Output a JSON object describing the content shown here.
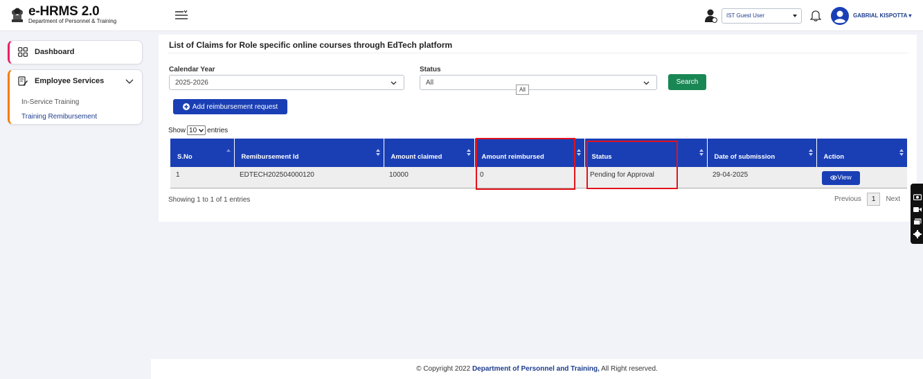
{
  "header": {
    "app_title": "e-HRMS 2.0",
    "app_subtitle": "Department of Personnel & Training",
    "role_selected": "IST Guest User",
    "user_name": "GABRIAL KISPOTTA",
    "user_caret": "▾"
  },
  "sidebar": {
    "items": [
      {
        "label": "Dashboard",
        "icon": "grid-icon",
        "accent": "#e91e63"
      },
      {
        "label": "Employee Services",
        "icon": "edit-document-icon",
        "accent": "#f57c00",
        "children": [
          {
            "label": "In-Service Training"
          },
          {
            "label": "Training Remibursement",
            "active": true
          }
        ]
      }
    ]
  },
  "main": {
    "title": "List of Claims for Role specific online courses through EdTech platform",
    "filters": {
      "year_label": "Calendar Year",
      "year_value": "2025-2026",
      "status_label": "Status",
      "status_value": "All",
      "status_tooltip": "All",
      "search_label": "Search"
    },
    "add_button_label": "Add reimbursement request",
    "length": {
      "prefix": "Show",
      "value": "10",
      "suffix": "entries"
    },
    "table": {
      "columns": [
        "S.No",
        "Remibursement Id",
        "Amount claimed",
        "Amount reimbursed",
        "Status",
        "Date of submission",
        "Action"
      ],
      "rows": [
        {
          "sno": "1",
          "id": "EDTECH202504000120",
          "claimed": "10000",
          "reimbursed": "0",
          "status": "Pending for Approval",
          "date": "29-04-2025",
          "action": "View"
        }
      ]
    },
    "info": "Showing 1 to 1 of 1 entries",
    "pager": {
      "prev": "Previous",
      "current": "1",
      "next": "Next"
    }
  },
  "footer": {
    "prefix": "© Copyright 2022",
    "org": "Department of Personnel and Training,",
    "suffix": "All Right reserved."
  },
  "colors": {
    "primary": "#1a3fb5",
    "success": "#198754",
    "highlight": "#e3121b"
  }
}
